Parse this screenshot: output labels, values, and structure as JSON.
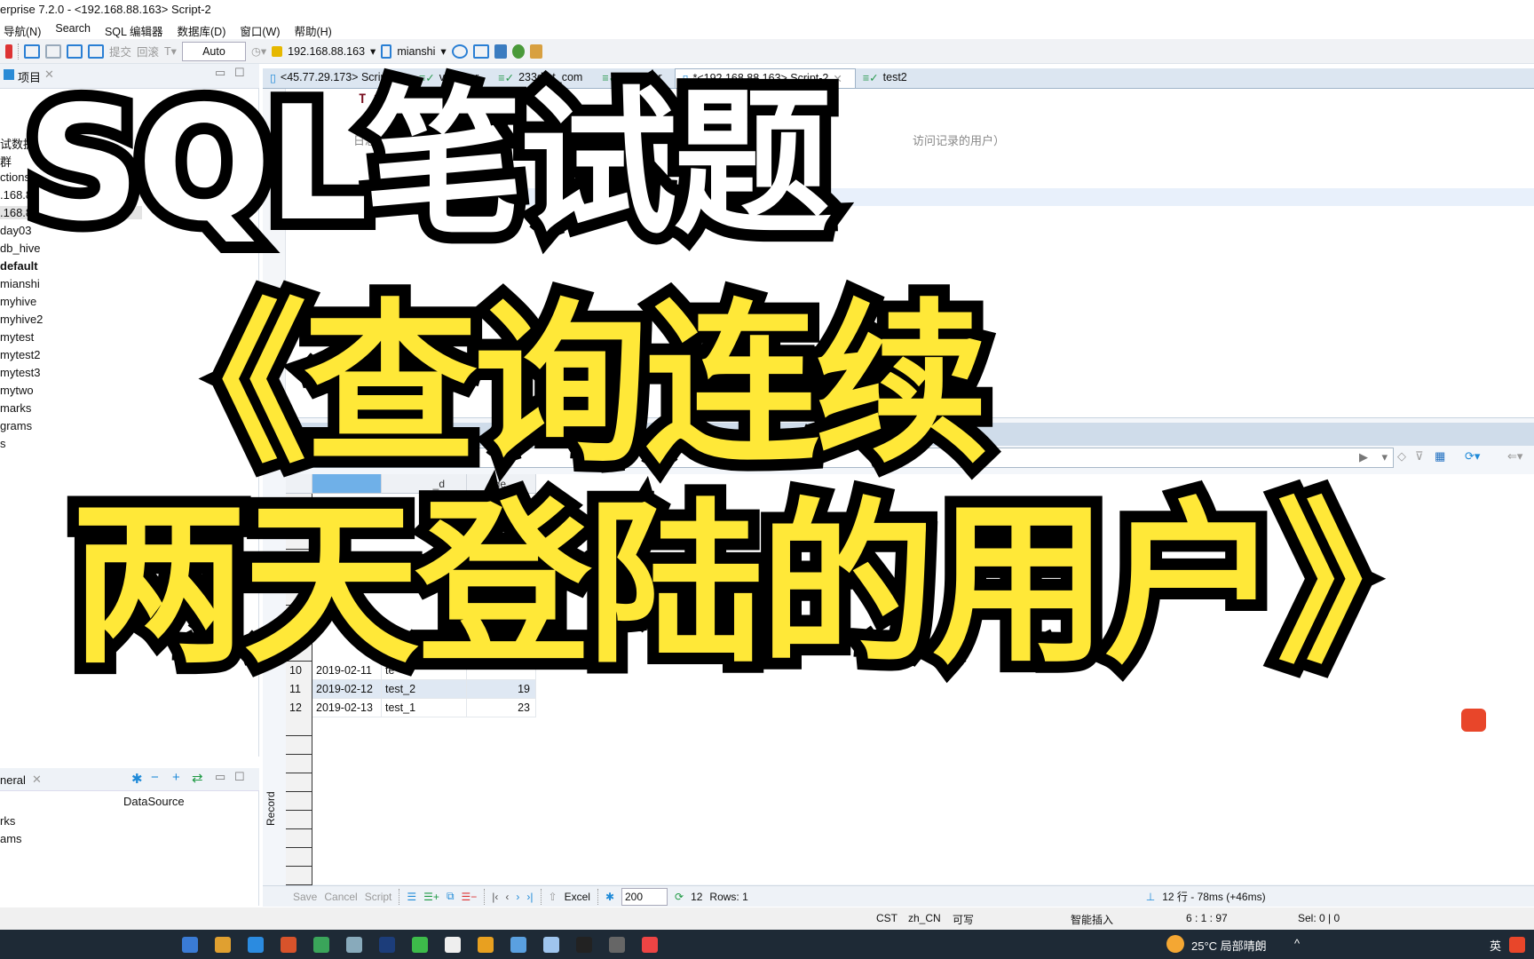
{
  "window": {
    "title": "erprise 7.2.0 - <192.168.88.163> Script-2"
  },
  "menu": [
    "导航(N)",
    "Search",
    "SQL 编辑器",
    "数据库(D)",
    "窗口(W)",
    "帮助(H)"
  ],
  "toolbar": {
    "commit": "提交",
    "rollback": "回滚",
    "mode": "Auto",
    "connection": "192.168.88.163",
    "database": "mianshi"
  },
  "left_panel": {
    "tab": "项目",
    "tree": [
      "试数据",
      "群",
      "ctions",
      ".168.8",
      ".168.8",
      "day03",
      "db_hive",
      "default",
      "mianshi",
      "myhive",
      "myhive2",
      "mytest",
      "mytest2",
      "mytest3",
      "mytwo",
      "marks",
      "grams",
      "s"
    ],
    "bottom_tab": "neral",
    "column": "DataSource",
    "items": [
      "rks",
      "ams"
    ]
  },
  "tabs": [
    "<45.77.29.173> Script-2",
    "v2_user",
    "233dmt_com",
    "v2_user",
    "*<192.168.88.163> Script-2",
    "test2"
  ],
  "editor": {
    "line1": "T * from",
    "comment_left": "日志如下，",
    "comment_right": "访问记录的用户）"
  },
  "grid": {
    "columns": [
      "",
      "_d",
      "age"
    ],
    "rows": [
      {
        "n": "10",
        "date": "2019-02-11",
        "user": "te",
        "age": ""
      },
      {
        "n": "11",
        "date": "2019-02-12",
        "user": "test_2",
        "age": "19"
      },
      {
        "n": "12",
        "date": "2019-02-13",
        "user": "test_1",
        "age": "23"
      }
    ]
  },
  "bottom_toolbar": {
    "save": "Save",
    "cancel": "Cancel",
    "script": "Script",
    "export": "Excel",
    "fetch_size": "200",
    "count": "12",
    "rows": "Rows: 1",
    "timing": "12 行 - 78ms (+46ms)",
    "record": "Record"
  },
  "status": {
    "tz": "CST",
    "locale": "zh_CN",
    "mode": "可写",
    "insert": "智能插入",
    "pos": "6 : 1 : 97",
    "sel": "Sel: 0 | 0"
  },
  "taskbar": {
    "weather": "25°C 局部晴朗",
    "ime": "英"
  },
  "overlay": {
    "line1": "SQL笔试题",
    "line2": "《查询连续",
    "line3": "两天登陆的用户》"
  }
}
